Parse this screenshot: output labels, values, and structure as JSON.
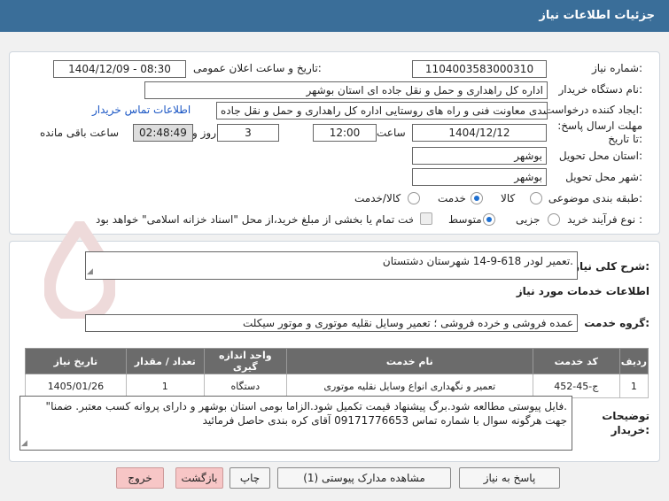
{
  "header": {
    "title": "جزئیات اطلاعات نیاز"
  },
  "form": {
    "need_number_label": "شماره نیاز:",
    "need_number": "1104003583000310",
    "announce_label": "تاریخ و ساعت اعلان عمومی:",
    "announce_value": "1404/12/09 - 08:30",
    "buyer_org_label": "نام دستگاه خریدار:",
    "buyer_org": "اداره کل راهداری و حمل و نقل جاده ای استان بوشهر",
    "creator_label": "ایجاد کننده درخواست:",
    "creator": "بهرام اسدی معاونت فنی و راه های روستایی اداره کل راهداری و حمل و نقل جاده",
    "contact_link": "اطلاعات تماس خریدار",
    "deadline_label": "مهلت ارسال پاسخ: تا تاریخ:",
    "deadline_date": "1404/12/12",
    "time_label": "ساعت",
    "deadline_time": "12:00",
    "days_value": "3",
    "days_label": "روز و",
    "remaining_time": "02:48:49",
    "remaining_label": "ساعت باقی مانده",
    "delivery_province_label": "استان محل تحویل:",
    "delivery_province": "بوشهر",
    "delivery_city_label": "شهر محل تحویل:",
    "delivery_city": "بوشهر",
    "category_label": "طبقه بندی موضوعی:",
    "category_options": [
      "کالا",
      "خدمت",
      "کالا/خدمت"
    ],
    "category_selected": "خدمت",
    "process_label": "نوع فرآیند خرید :",
    "process_options": [
      "جزیی",
      "متوسط"
    ],
    "process_selected": "متوسط",
    "payment_note": "پرداخت تمام یا بخشی از مبلغ خرید،از محل \"اسناد خزانه اسلامی\" خواهد بود."
  },
  "summary": {
    "label": "شرح کلی نیاز:",
    "text": "تعمیر لودر 618-9-14 شهرستان دشتستان."
  },
  "services": {
    "section_title": "اطلاعات خدمات مورد نیاز",
    "group_label": "گروه خدمت:",
    "group_value": "عمده فروشی و خرده فروشی ؛ تعمیر وسایل نقلیه موتوری و موتور سیکلت",
    "table": {
      "headers": [
        "ردیف",
        "کد خدمت",
        "نام خدمت",
        "واحد اندازه گیری",
        "تعداد / مقدار",
        "تاریخ نیاز"
      ],
      "rows": [
        [
          "1",
          "ج-45-452",
          "تعمیر و نگهداری انواع وسایل نقلیه موتوری",
          "دستگاه",
          "1",
          "1405/01/26"
        ]
      ]
    }
  },
  "notes": {
    "label": "توضیحات خریدار:",
    "line1": ".فایل پیوستی مطالعه شود.برگ پیشنهاد قیمت تکمیل شود.الزاما بومی استان بوشهر و دارای پروانه کسب معتبر. ضمنا\"",
    "line2": "جهت هرگونه سوال با شماره تماس 09171776653 آقای کره بندی حاصل فرمائید"
  },
  "watermark": "AriaTender.net",
  "buttons": {
    "reply": "پاسخ به نیاز",
    "attachments": "مشاهده مدارک پیوستی (1)",
    "print": "چاپ",
    "back": "بازگشت",
    "exit": "خروج"
  }
}
